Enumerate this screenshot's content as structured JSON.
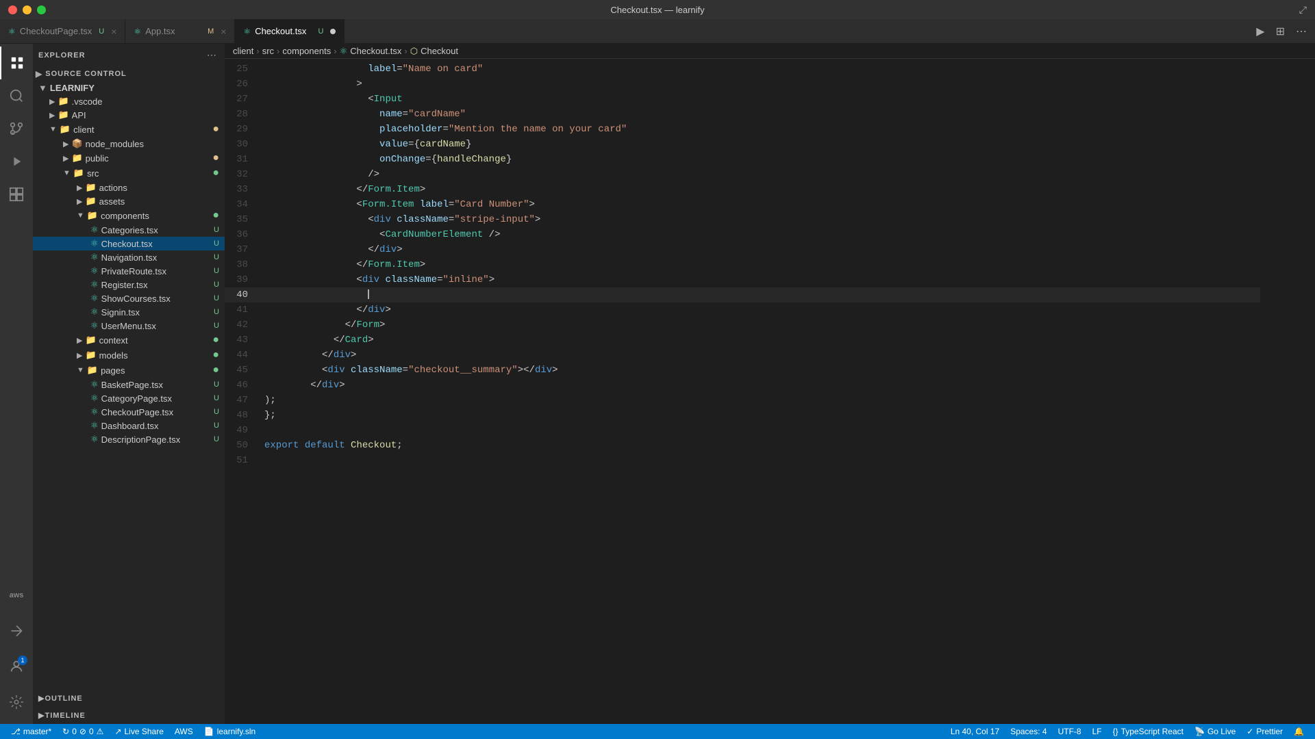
{
  "titlebar": {
    "title": "Checkout.tsx — learnify",
    "buttons": [
      "close",
      "minimize",
      "maximize"
    ]
  },
  "tabs": [
    {
      "id": "checkoutpage",
      "label": "CheckoutPage.tsx",
      "badge": "U",
      "icon": "📄",
      "active": false,
      "modified": false
    },
    {
      "id": "app",
      "label": "App.tsx",
      "badge": "M",
      "icon": "📄",
      "active": false,
      "modified": false
    },
    {
      "id": "checkout",
      "label": "Checkout.tsx",
      "badge": "U",
      "icon": "📄",
      "active": true,
      "modified": true
    }
  ],
  "breadcrumb": {
    "parts": [
      "client",
      "src",
      "components",
      "Checkout.tsx",
      "Checkout"
    ]
  },
  "sidebar": {
    "explorer_title": "EXPLORER",
    "source_control_title": "SOURCE CONTROL",
    "root": "LEARNIFY",
    "tree": [
      {
        "label": ".vscode",
        "type": "folder",
        "depth": 1,
        "icon": "📁",
        "badge": ""
      },
      {
        "label": "API",
        "type": "folder",
        "depth": 1,
        "icon": "📁",
        "badge": ""
      },
      {
        "label": "client",
        "type": "folder",
        "depth": 1,
        "icon": "📁",
        "badge": "●",
        "dot": "orange",
        "expanded": true
      },
      {
        "label": "node_modules",
        "type": "folder",
        "depth": 2,
        "icon": "📦",
        "badge": ""
      },
      {
        "label": "public",
        "type": "folder",
        "depth": 2,
        "icon": "📁",
        "badge": "●",
        "dot": "orange"
      },
      {
        "label": "src",
        "type": "folder",
        "depth": 2,
        "icon": "📁",
        "badge": "●",
        "dot": "green",
        "expanded": true
      },
      {
        "label": "actions",
        "type": "folder",
        "depth": 3,
        "icon": "📁",
        "badge": ""
      },
      {
        "label": "assets",
        "type": "folder",
        "depth": 3,
        "icon": "📁",
        "badge": ""
      },
      {
        "label": "components",
        "type": "folder",
        "depth": 3,
        "icon": "📁",
        "badge": "●",
        "dot": "green",
        "expanded": true
      },
      {
        "label": "Categories.tsx",
        "type": "file",
        "depth": 4,
        "icon": "⚛",
        "badge": "U",
        "badgeClass": "badge-u"
      },
      {
        "label": "Checkout.tsx",
        "type": "file",
        "depth": 4,
        "icon": "⚛",
        "badge": "U",
        "badgeClass": "badge-u",
        "selected": true
      },
      {
        "label": "Navigation.tsx",
        "type": "file",
        "depth": 4,
        "icon": "⚛",
        "badge": "U",
        "badgeClass": "badge-u"
      },
      {
        "label": "PrivateRoute.tsx",
        "type": "file",
        "depth": 4,
        "icon": "⚛",
        "badge": "U",
        "badgeClass": "badge-u"
      },
      {
        "label": "Register.tsx",
        "type": "file",
        "depth": 4,
        "icon": "⚛",
        "badge": "U",
        "badgeClass": "badge-u"
      },
      {
        "label": "ShowCourses.tsx",
        "type": "file",
        "depth": 4,
        "icon": "⚛",
        "badge": "U",
        "badgeClass": "badge-u"
      },
      {
        "label": "Signin.tsx",
        "type": "file",
        "depth": 4,
        "icon": "⚛",
        "badge": "U",
        "badgeClass": "badge-u"
      },
      {
        "label": "UserMenu.tsx",
        "type": "file",
        "depth": 4,
        "icon": "⚛",
        "badge": "U",
        "badgeClass": "badge-u"
      },
      {
        "label": "context",
        "type": "folder",
        "depth": 3,
        "icon": "📁",
        "badge": "●",
        "dot": "green"
      },
      {
        "label": "models",
        "type": "folder",
        "depth": 3,
        "icon": "📁",
        "badge": "●",
        "dot": "green"
      },
      {
        "label": "pages",
        "type": "folder",
        "depth": 3,
        "icon": "📁",
        "badge": "●",
        "dot": "green",
        "expanded": true
      },
      {
        "label": "BasketPage.tsx",
        "type": "file",
        "depth": 4,
        "icon": "⚛",
        "badge": "U",
        "badgeClass": "badge-u"
      },
      {
        "label": "CategoryPage.tsx",
        "type": "file",
        "depth": 4,
        "icon": "⚛",
        "badge": "U",
        "badgeClass": "badge-u"
      },
      {
        "label": "CheckoutPage.tsx",
        "type": "file",
        "depth": 4,
        "icon": "⚛",
        "badge": "U",
        "badgeClass": "badge-u"
      },
      {
        "label": "Dashboard.tsx",
        "type": "file",
        "depth": 4,
        "icon": "⚛",
        "badge": "U",
        "badgeClass": "badge-u"
      },
      {
        "label": "DescriptionPage.tsx",
        "type": "file",
        "depth": 4,
        "icon": "⚛",
        "badge": "U",
        "badgeClass": "badge-u"
      }
    ],
    "outline_title": "OUTLINE",
    "timeline_title": "TIMELINE"
  },
  "code": {
    "lines": [
      {
        "num": 25,
        "content": "         label=\"Name on card\""
      },
      {
        "num": 26,
        "content": "       >"
      },
      {
        "num": 27,
        "content": "         <Input"
      },
      {
        "num": 28,
        "content": "           name=\"cardName\""
      },
      {
        "num": 29,
        "content": "           placeholder=\"Mention the name on your card\""
      },
      {
        "num": 30,
        "content": "           value={cardName}"
      },
      {
        "num": 31,
        "content": "           onChange={handleChange}"
      },
      {
        "num": 32,
        "content": "         />"
      },
      {
        "num": 33,
        "content": "       </Form.Item>"
      },
      {
        "num": 34,
        "content": "       <Form.Item label=\"Card Number\">"
      },
      {
        "num": 35,
        "content": "         <div className=\"stripe-input\">"
      },
      {
        "num": 36,
        "content": "           <CardNumberElement />"
      },
      {
        "num": 37,
        "content": "         </div>"
      },
      {
        "num": 38,
        "content": "       </Form.Item>"
      },
      {
        "num": 39,
        "content": "       <div className=\"inline\">"
      },
      {
        "num": 40,
        "content": "         |",
        "active": true,
        "cursor": true
      },
      {
        "num": 41,
        "content": "       </div>"
      },
      {
        "num": 42,
        "content": "     </Form>"
      },
      {
        "num": 43,
        "content": "   </Card>"
      },
      {
        "num": 44,
        "content": " </div>"
      },
      {
        "num": 45,
        "content": "   <div className=\"checkout__summary\"></div>"
      },
      {
        "num": 46,
        "content": " </div>"
      },
      {
        "num": 47,
        "content": ");"
      },
      {
        "num": 48,
        "content": "};"
      },
      {
        "num": 49,
        "content": ""
      },
      {
        "num": 50,
        "content": "export default Checkout;"
      },
      {
        "num": 51,
        "content": ""
      }
    ]
  },
  "statusbar": {
    "branch": "master*",
    "sync_icon": "↻",
    "errors": "0",
    "warnings": "0",
    "live_share": "Live Share",
    "aws": "AWS",
    "filename": "learnify.sln",
    "position": "Ln 40, Col 17",
    "spaces": "Spaces: 4",
    "encoding": "UTF-8",
    "line_ending": "LF",
    "language": "TypeScript React",
    "go_live": "Go Live",
    "prettier": "Prettier"
  },
  "activity": {
    "items": [
      {
        "id": "explorer",
        "icon": "⬜",
        "unicode": "🗂",
        "active": true,
        "badge": null
      },
      {
        "id": "search",
        "icon": "🔍",
        "active": false,
        "badge": null
      },
      {
        "id": "git",
        "icon": "⎇",
        "active": false,
        "badge": null
      },
      {
        "id": "debug",
        "icon": "▶",
        "active": false,
        "badge": null
      },
      {
        "id": "extensions",
        "icon": "⊞",
        "active": false,
        "badge": null
      }
    ],
    "bottom": [
      {
        "id": "aws",
        "label": "aws",
        "active": false
      },
      {
        "id": "remote",
        "icon": "⟩⟨",
        "active": false
      },
      {
        "id": "settings",
        "icon": "⚙",
        "active": false
      },
      {
        "id": "account",
        "icon": "👤",
        "badge": "1"
      }
    ]
  }
}
